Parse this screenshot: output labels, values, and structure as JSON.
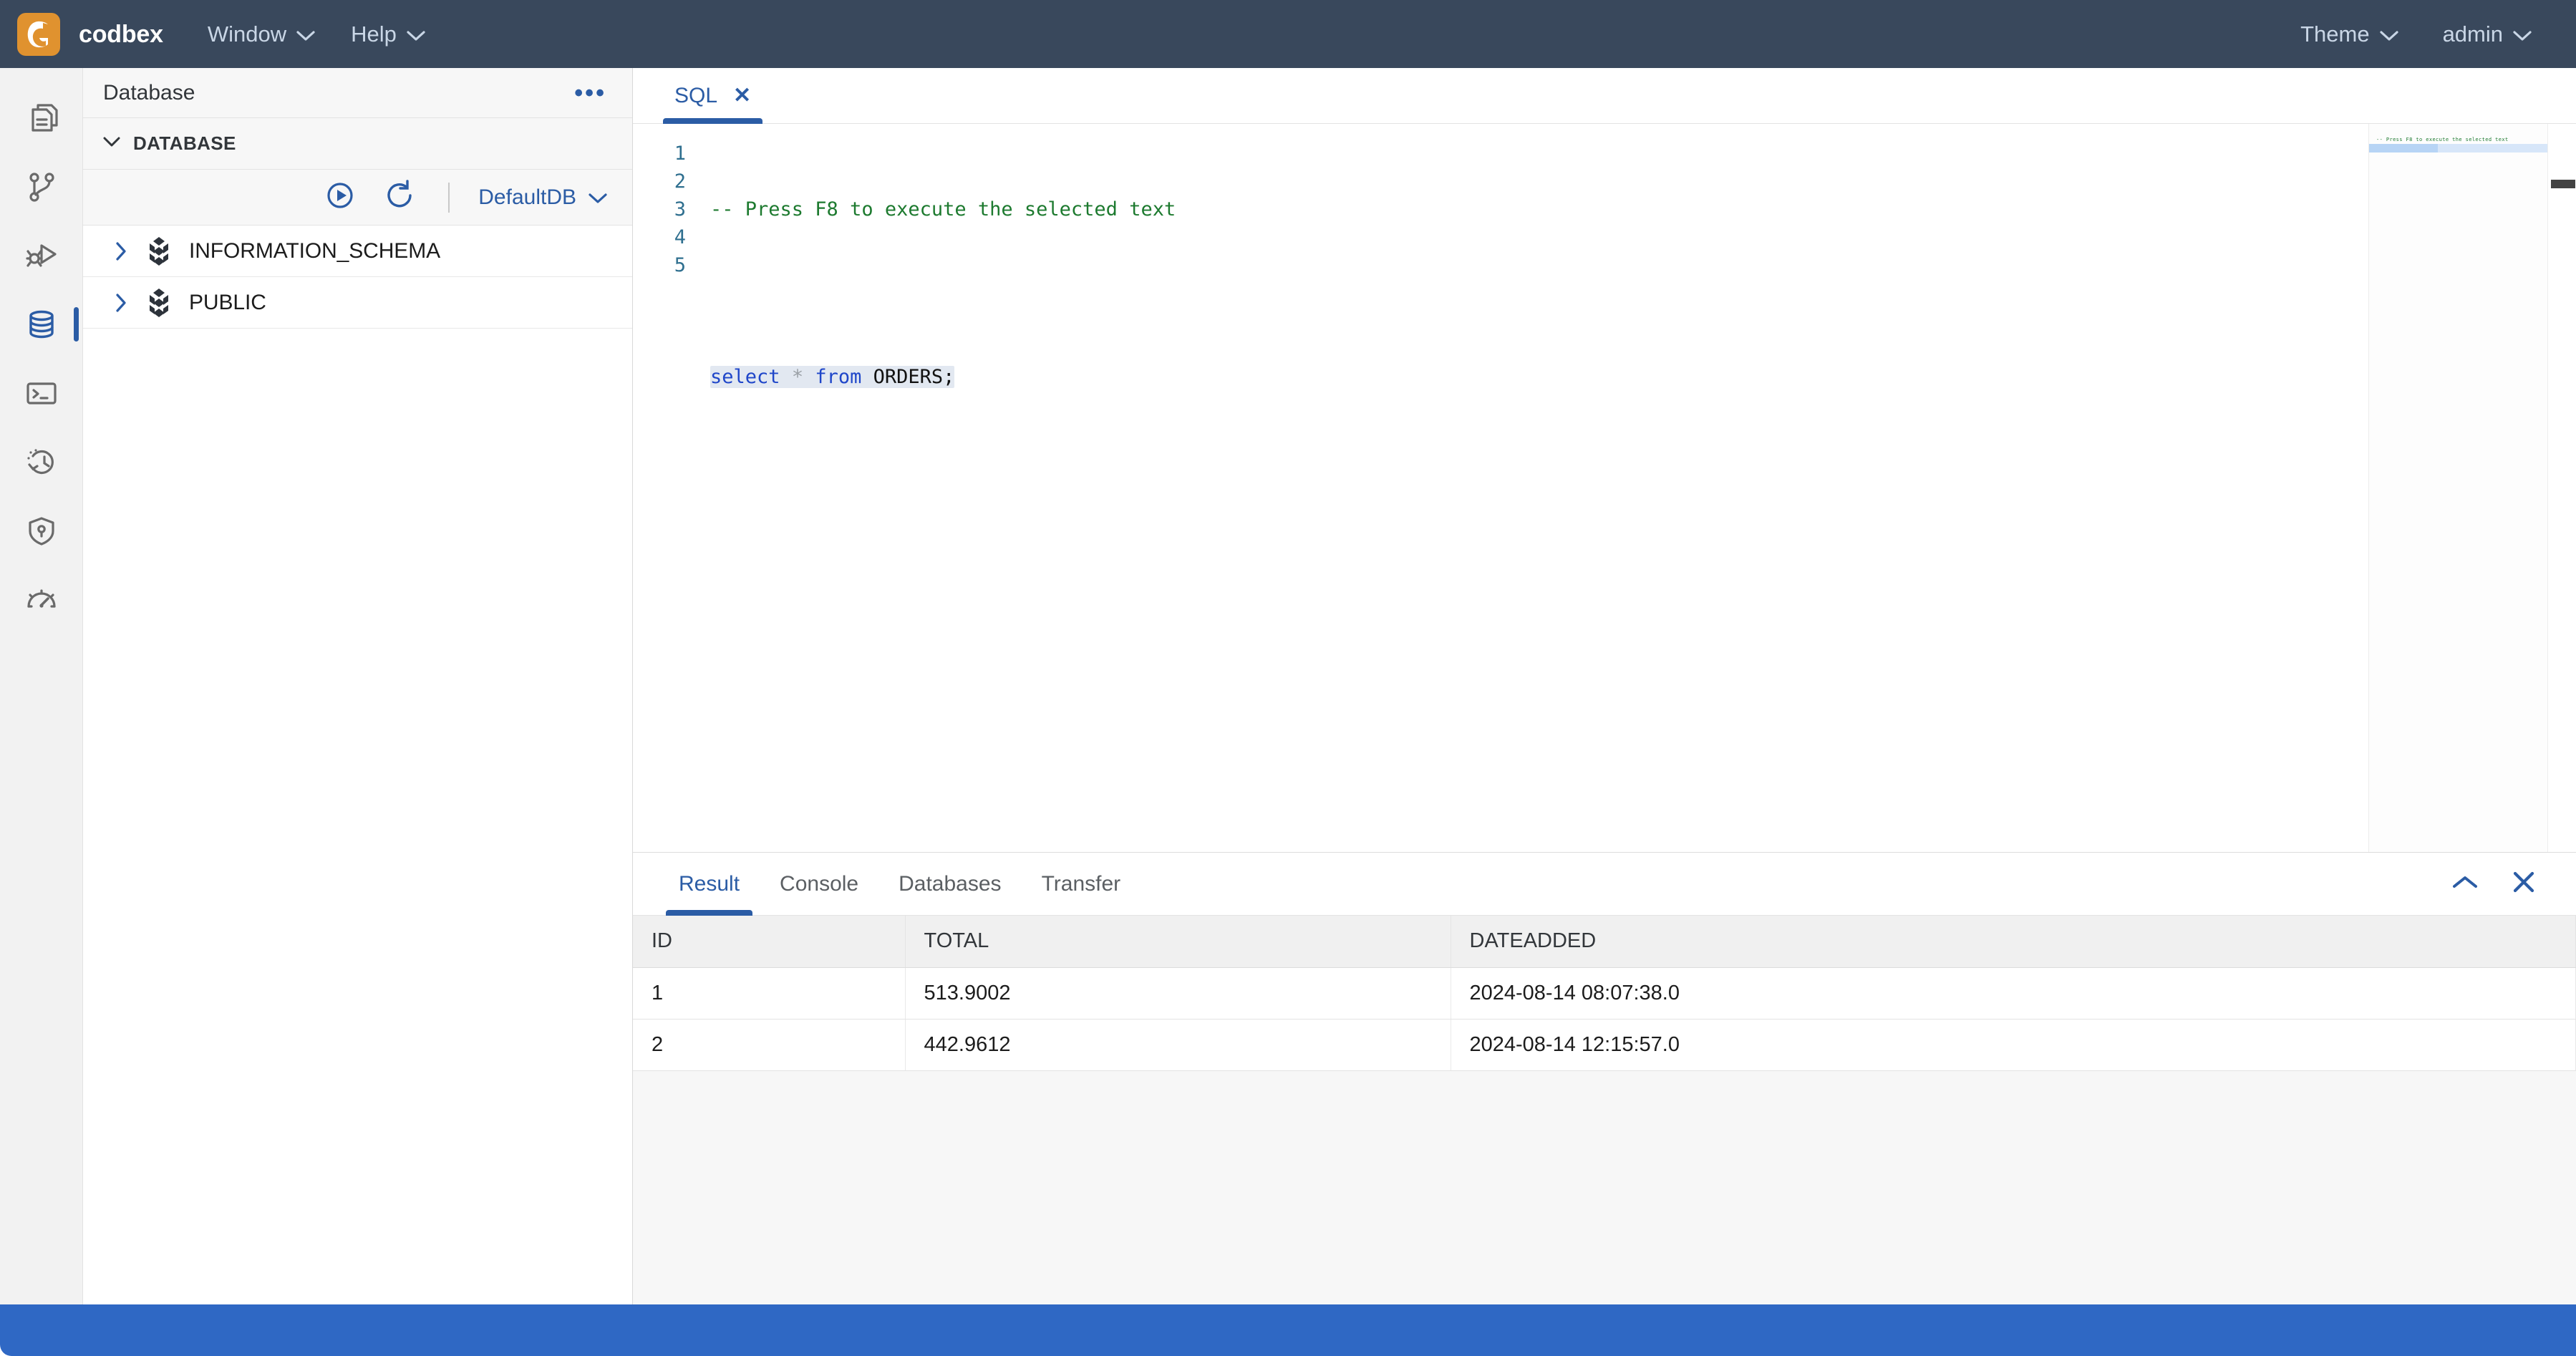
{
  "topbar": {
    "brand": "codbex",
    "logo_color": "#e0922f",
    "background": "#39485c",
    "menus": [
      {
        "label": "Window",
        "icon": "chevron-down-icon"
      },
      {
        "label": "Help",
        "icon": "chevron-down-icon"
      }
    ],
    "right_menus": [
      {
        "label": "Theme",
        "icon": "chevron-down-icon"
      },
      {
        "label": "admin",
        "icon": "chevron-down-icon"
      }
    ]
  },
  "activity_bar": {
    "items": [
      {
        "icon": "files-icon",
        "active": false
      },
      {
        "icon": "git-branch-icon",
        "active": false
      },
      {
        "icon": "debug-icon",
        "active": false
      },
      {
        "icon": "database-icon",
        "active": true
      },
      {
        "icon": "terminal-icon",
        "active": false
      },
      {
        "icon": "history-clock-icon",
        "active": false
      },
      {
        "icon": "shield-lock-icon",
        "active": false
      },
      {
        "icon": "gauge-icon",
        "active": false
      }
    ],
    "active_color": "#2b5ca5",
    "inactive_color": "#6a6a6a"
  },
  "sidepanel": {
    "title": "Database",
    "more_label": "•••",
    "section": {
      "label": "DATABASE",
      "expanded": true
    },
    "toolbar": {
      "run_icon": "play-circle-icon",
      "refresh_icon": "refresh-icon",
      "datasource": "DefaultDB",
      "datasource_chevron": "chevron-down-icon"
    },
    "tree": [
      {
        "label": "INFORMATION_SCHEMA",
        "icon": "schema-cube-icon",
        "expanded": false
      },
      {
        "label": "PUBLIC",
        "icon": "schema-cube-icon",
        "expanded": false
      }
    ]
  },
  "editor": {
    "tabs": [
      {
        "label": "SQL",
        "active": true,
        "close": "✕"
      }
    ],
    "line_numbers": [
      "1",
      "2",
      "3",
      "4",
      "5"
    ],
    "code": {
      "line1_comment": "-- Press F8 to execute the selected text",
      "line3": {
        "kw1": "select",
        "op": "*",
        "kw2": "from",
        "identifier": "ORDERS;"
      }
    },
    "minimap_text": "-- Press F8 to execute the selected text"
  },
  "bottom_panel": {
    "tabs": [
      {
        "label": "Result",
        "active": true
      },
      {
        "label": "Console",
        "active": false
      },
      {
        "label": "Databases",
        "active": false
      },
      {
        "label": "Transfer",
        "active": false
      }
    ],
    "actions": [
      {
        "icon": "chevron-up-icon",
        "name": "maximize"
      },
      {
        "icon": "close-icon",
        "name": "close"
      }
    ],
    "result_table": {
      "columns": [
        "ID",
        "TOTAL",
        "DATEADDED"
      ],
      "rows": [
        [
          "1",
          "513.9002",
          "2024-08-14 08:07:38.0"
        ],
        [
          "2",
          "442.9612",
          "2024-08-14 12:15:57.0"
        ]
      ]
    }
  },
  "statusbar": {
    "color": "#2f68c4",
    "text": ""
  }
}
